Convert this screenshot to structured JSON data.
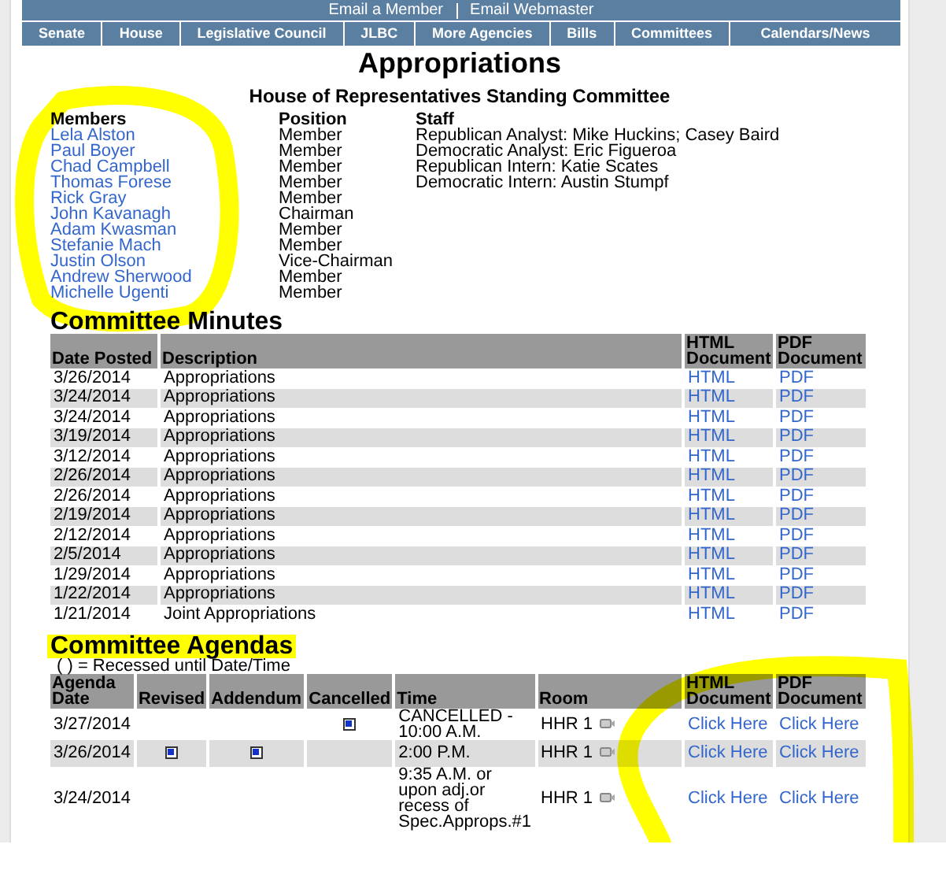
{
  "top_links": [
    "Email a Member",
    "Email Webmaster"
  ],
  "nav": [
    "Senate",
    "House",
    "Legislative Council",
    "JLBC",
    "More Agencies",
    "Bills",
    "Committees",
    "Calendars/News"
  ],
  "title": "Appropriations",
  "subtitle": "House of Representatives Standing Committee",
  "members": {
    "headers": [
      "Members",
      "Position",
      "Staff"
    ],
    "rows": [
      {
        "name": "Lela Alston",
        "position": "Member"
      },
      {
        "name": "Paul Boyer",
        "position": "Member"
      },
      {
        "name": "Chad Campbell",
        "position": "Member"
      },
      {
        "name": "Thomas Forese",
        "position": "Member"
      },
      {
        "name": "Rick Gray",
        "position": "Member"
      },
      {
        "name": "John Kavanagh",
        "position": "Chairman"
      },
      {
        "name": "Adam Kwasman",
        "position": "Member"
      },
      {
        "name": "Stefanie Mach",
        "position": "Member"
      },
      {
        "name": "Justin Olson",
        "position": "Vice-Chairman"
      },
      {
        "name": "Andrew Sherwood",
        "position": "Member"
      },
      {
        "name": "Michelle Ugenti",
        "position": "Member"
      }
    ],
    "staff": [
      "Republican Analyst: Mike Huckins; Casey Baird",
      "Democratic Analyst: Eric Figueroa",
      "Republican Intern: Katie Scates",
      "Democratic Intern: Austin Stumpf"
    ]
  },
  "minutes": {
    "title": "Committee Minutes",
    "columns": [
      "Date Posted",
      "Description",
      "HTML Document",
      "PDF Document"
    ],
    "rows": [
      {
        "date": "3/26/2014",
        "description": "Appropriations",
        "html": "HTML",
        "pdf": "PDF"
      },
      {
        "date": "3/24/2014",
        "description": "Appropriations",
        "html": "HTML",
        "pdf": "PDF"
      },
      {
        "date": "3/24/2014",
        "description": "Appropriations",
        "html": "HTML",
        "pdf": "PDF"
      },
      {
        "date": "3/19/2014",
        "description": "Appropriations",
        "html": "HTML",
        "pdf": "PDF"
      },
      {
        "date": "3/12/2014",
        "description": "Appropriations",
        "html": "HTML",
        "pdf": "PDF"
      },
      {
        "date": "2/26/2014",
        "description": "Appropriations",
        "html": "HTML",
        "pdf": "PDF"
      },
      {
        "date": "2/26/2014",
        "description": "Appropriations",
        "html": "HTML",
        "pdf": "PDF"
      },
      {
        "date": "2/19/2014",
        "description": "Appropriations",
        "html": "HTML",
        "pdf": "PDF"
      },
      {
        "date": "2/12/2014",
        "description": "Appropriations",
        "html": "HTML",
        "pdf": "PDF"
      },
      {
        "date": "2/5/2014",
        "description": "Appropriations",
        "html": "HTML",
        "pdf": "PDF"
      },
      {
        "date": "1/29/2014",
        "description": "Appropriations",
        "html": "HTML",
        "pdf": "PDF"
      },
      {
        "date": "1/22/2014",
        "description": "Appropriations",
        "html": "HTML",
        "pdf": "PDF"
      },
      {
        "date": "1/21/2014",
        "description": "Joint Appropriations",
        "html": "HTML",
        "pdf": "PDF"
      }
    ]
  },
  "agendas": {
    "title": "Committee Agendas",
    "legend": "( ) = Recessed until Date/Time",
    "columns": [
      "Agenda Date",
      "Revised",
      "Addendum",
      "Cancelled",
      "Time",
      "Room",
      "HTML Document",
      "PDF Document"
    ],
    "rows": [
      {
        "date": "3/27/2014",
        "revised": false,
        "addendum": false,
        "cancelled": true,
        "time": "CANCELLED - 10:00 A.M.",
        "room": "HHR 1",
        "html": "Click Here",
        "pdf": "Click Here"
      },
      {
        "date": "3/26/2014",
        "revised": true,
        "addendum": true,
        "cancelled": false,
        "time": "2:00 P.M.",
        "room": "HHR 1",
        "html": "Click Here",
        "pdf": "Click Here"
      },
      {
        "date": "3/24/2014",
        "revised": false,
        "addendum": false,
        "cancelled": false,
        "time": "9:35 A.M. or upon adj.or recess of Spec.Approps.#1",
        "room": "HHR 1",
        "html": "Click Here",
        "pdf": "Click Here"
      }
    ]
  }
}
